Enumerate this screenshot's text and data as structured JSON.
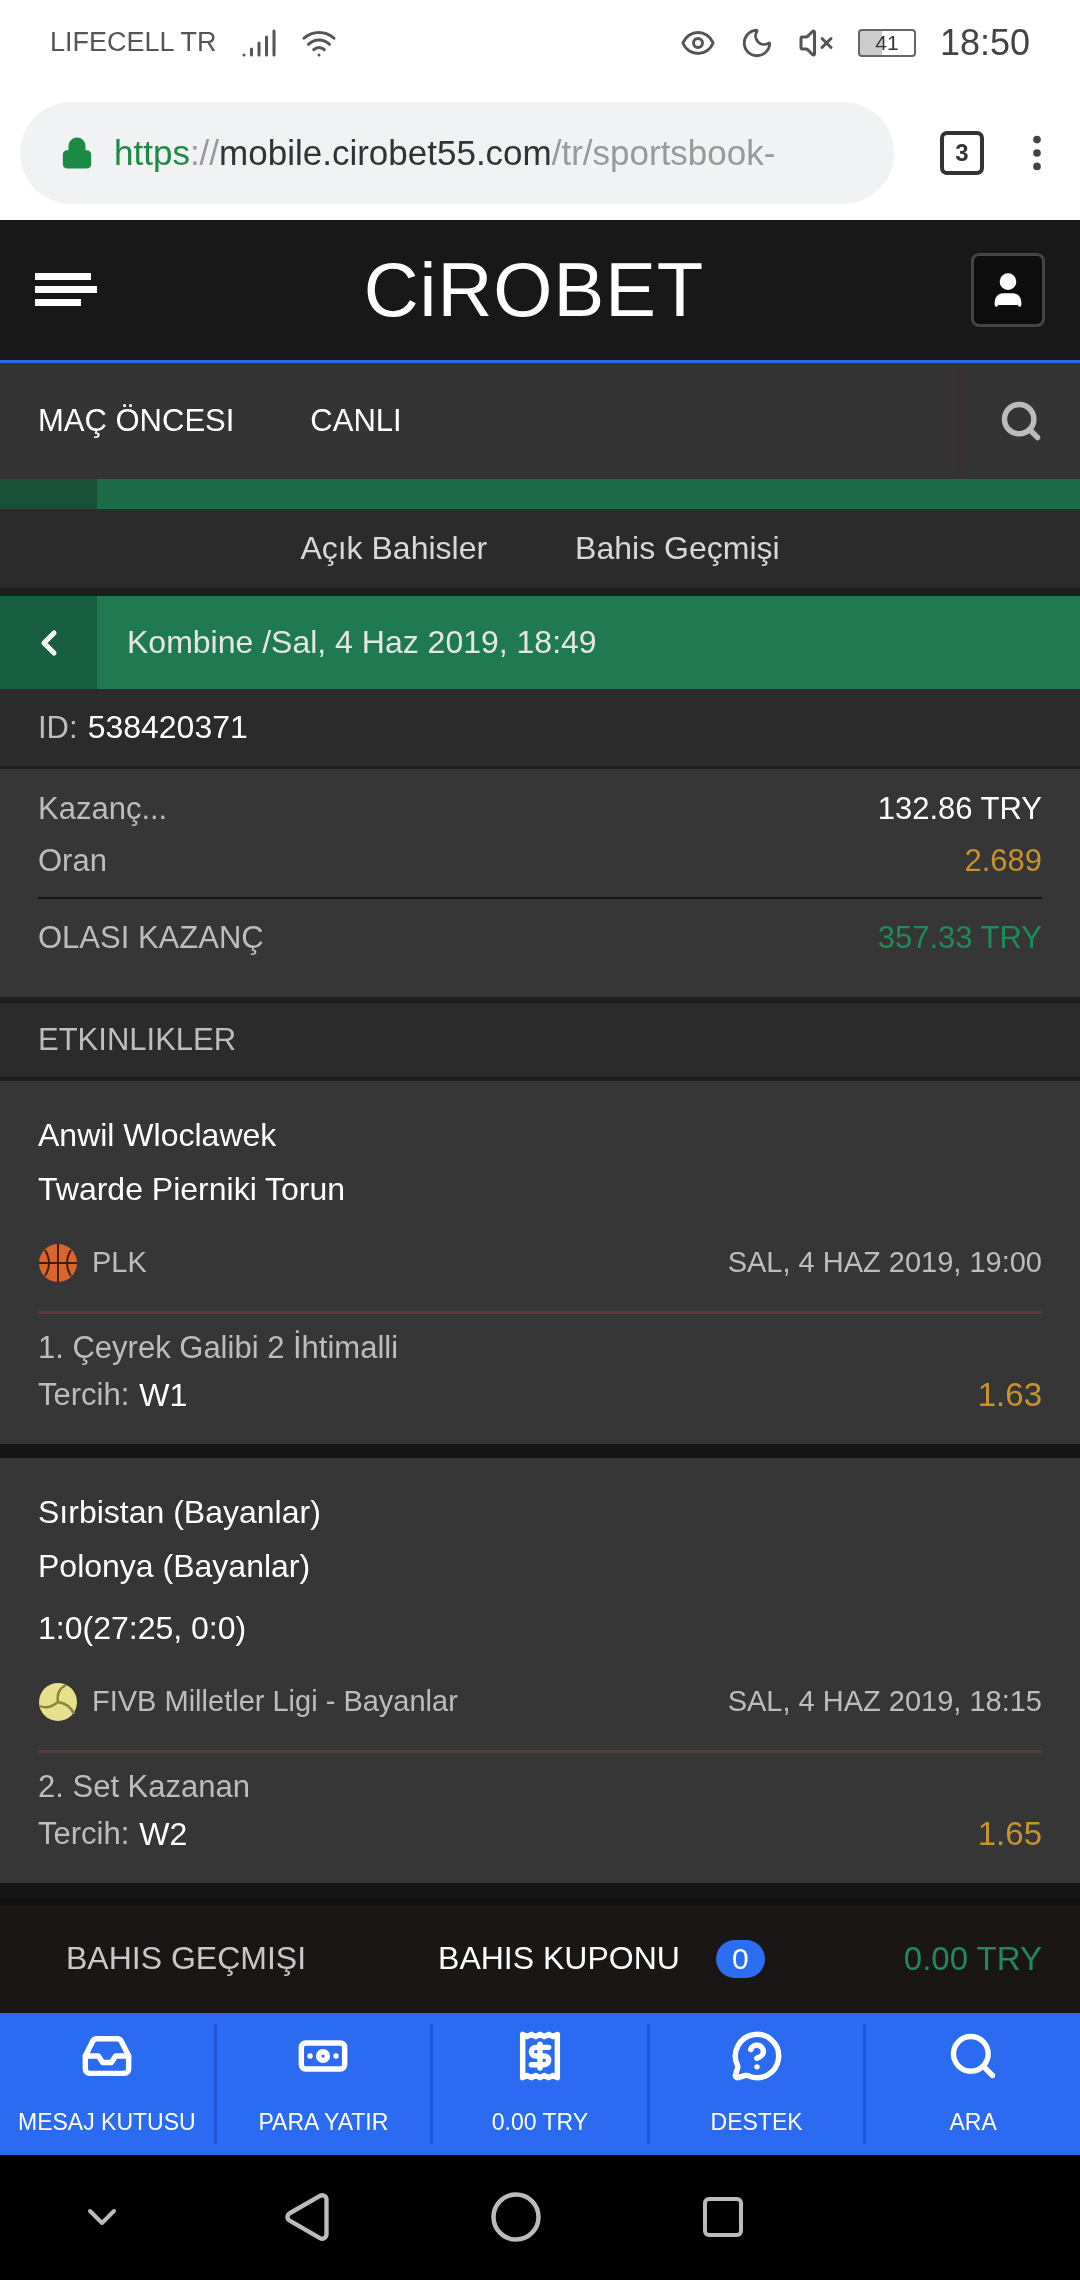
{
  "status_bar": {
    "carrier": "LIFECELL TR",
    "battery": "41",
    "time": "18:50"
  },
  "browser": {
    "url_scheme": "https",
    "url_sep": "://",
    "url_host": "mobile.cirobet55.com",
    "url_path": "/tr/sportsbook-",
    "tab_count": "3"
  },
  "header": {
    "logo": "CiROBET"
  },
  "nav": {
    "tabs": [
      {
        "label": "MAÇ ÖNCESI",
        "selected": false
      },
      {
        "label": "CANLI",
        "selected": false
      }
    ]
  },
  "sub_tabs": [
    {
      "label": "Açık Bahisler",
      "selected": false
    },
    {
      "label": "Bahis Geçmişi",
      "selected": false
    }
  ],
  "bet": {
    "title": "Kombine /Sal, 4 Haz 2019, 18:49",
    "id_label": "ID:",
    "id": "538420371",
    "summary": [
      {
        "label": "Kazanç...",
        "value": "132.86 TRY",
        "kind": "plain"
      },
      {
        "label": "Oran",
        "value": "2.689",
        "kind": "odds"
      },
      {
        "label": "OLASI KAZANÇ",
        "value": "357.33 TRY",
        "kind": "total"
      }
    ]
  },
  "events_heading": "ETKINLIKLER",
  "events": [
    {
      "teams": [
        "Anwil Wloclawek",
        "Twarde Pierniki Torun"
      ],
      "kind": "basketball",
      "league": "PLK",
      "datetime": "SAL, 4 HAZ 2019, 19:00",
      "market": "1. Çeyrek Galibi 2 İhtimalli",
      "pick_label": "Tercih:",
      "pick": "W1",
      "odds": "1.63"
    },
    {
      "teams": [
        "Sırbistan (Bayanlar)",
        "Polonya (Bayanlar)"
      ],
      "score": "1:0(27:25, 0:0)",
      "kind": "volleyball",
      "league": "FIVB Milletler Ligi - Bayanlar",
      "datetime": "SAL, 4 HAZ 2019, 18:15",
      "market": "2. Set Kazanan",
      "pick_label": "Tercih:",
      "pick": "W2",
      "odds": "1.65"
    }
  ],
  "betslip_bar": {
    "history": "BAHIS GEÇMIŞI",
    "coupon": "BAHIS KUPONU",
    "count": "0",
    "amount": "0.00 TRY"
  },
  "bottom_nav": [
    {
      "label": "MESAJ KUTUSU",
      "kind": "inbox"
    },
    {
      "label": "PARA YATIR",
      "kind": "deposit"
    },
    {
      "label": "0.00 TRY",
      "kind": "balance"
    },
    {
      "label": "DESTEK",
      "kind": "support"
    },
    {
      "label": "ARA",
      "kind": "search"
    }
  ]
}
